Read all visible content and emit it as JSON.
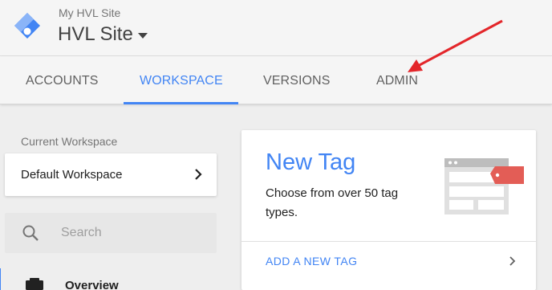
{
  "header": {
    "account_name": "My HVL Site",
    "container_name": "HVL Site",
    "brand_color": "#4285f4"
  },
  "tabs": [
    {
      "label": "ACCOUNTS",
      "active": false
    },
    {
      "label": "WORKSPACE",
      "active": true
    },
    {
      "label": "VERSIONS",
      "active": false
    },
    {
      "label": "ADMIN",
      "active": false
    }
  ],
  "sidebar": {
    "current_workspace_label": "Current Workspace",
    "workspace_name": "Default Workspace",
    "search_placeholder": "Search",
    "nav_items": [
      {
        "label": "Overview",
        "icon": "briefcase-icon"
      }
    ]
  },
  "new_tag_card": {
    "title": "New Tag",
    "description": "Choose from over 50 tag types.",
    "action_label": "ADD A NEW TAG",
    "illustration": "tag-window-illustration",
    "accent_red": "#e35d56"
  },
  "annotation": {
    "type": "arrow",
    "color": "#e3262a",
    "points_to": "ADMIN"
  }
}
